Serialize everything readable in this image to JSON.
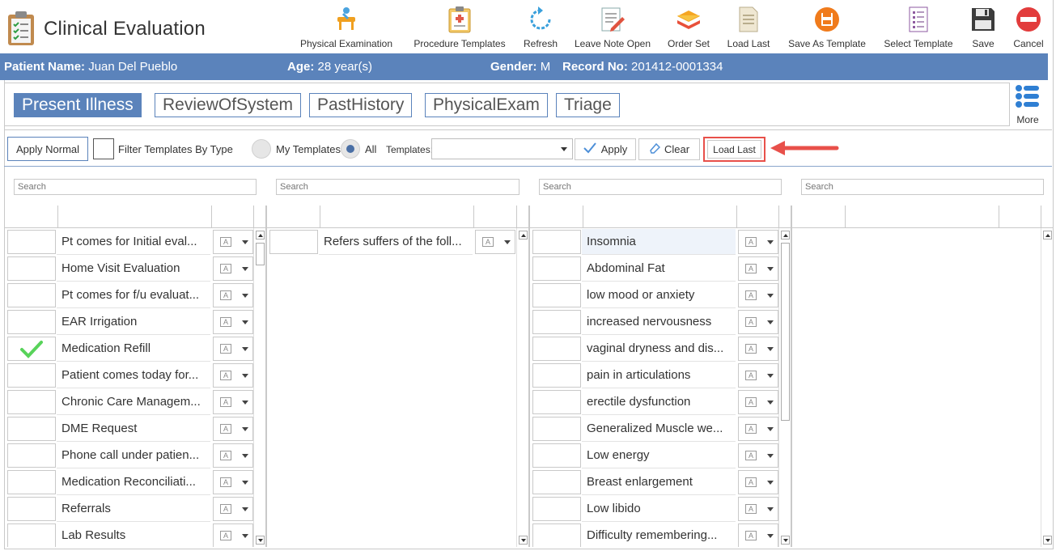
{
  "app": {
    "title": "Clinical Evaluation"
  },
  "toolbar": {
    "items": [
      {
        "label": "Physical Examination",
        "icon": "physical-exam-icon"
      },
      {
        "label": "Procedure Templates",
        "icon": "clipboard-icon"
      },
      {
        "label": "Refresh",
        "icon": "refresh-icon"
      },
      {
        "label": "Leave Note Open",
        "icon": "note-pencil-icon"
      },
      {
        "label": "Order Set",
        "icon": "layers-icon"
      },
      {
        "label": "Load Last",
        "icon": "document-icon"
      },
      {
        "label": "Save As Template",
        "icon": "save-template-icon"
      },
      {
        "label": "Select Template",
        "icon": "list-document-icon"
      },
      {
        "label": "Save",
        "icon": "floppy-icon"
      },
      {
        "label": "Cancel",
        "icon": "cancel-icon"
      }
    ]
  },
  "patient": {
    "name_label": "Patient Name:",
    "name": "Juan Del Pueblo",
    "age_label": "Age:",
    "age": "28 year(s)",
    "gender_label": "Gender:",
    "gender": "M",
    "record_label": "Record No:",
    "record": "201412-0001334"
  },
  "tabs": [
    {
      "label": "Present Illness",
      "active": true
    },
    {
      "label": "ReviewOfSystem",
      "active": false
    },
    {
      "label": "PastHistory",
      "active": false
    },
    {
      "label": "PhysicalExam",
      "active": false
    },
    {
      "label": "Triage",
      "active": false
    }
  ],
  "more": {
    "label": "More"
  },
  "filters": {
    "apply_normal": "Apply Normal",
    "filter_by_type": "Filter Templates By Type",
    "my_templates": "My Templates",
    "all": "All",
    "templates_label": "Templates:",
    "templates_value": "",
    "apply": "Apply",
    "clear": "Clear",
    "load_last": "Load Last"
  },
  "search_placeholder": "Search",
  "columns": [
    {
      "rows": [
        {
          "text": "Pt comes for Initial eval...",
          "checked": false
        },
        {
          "text": "Home Visit Evaluation",
          "checked": false
        },
        {
          "text": "Pt comes for f/u evaluat...",
          "checked": false
        },
        {
          "text": "EAR Irrigation",
          "checked": false
        },
        {
          "text": "Medication Refill",
          "checked": true
        },
        {
          "text": "Patient comes today for...",
          "checked": false
        },
        {
          "text": "Chronic Care Managem...",
          "checked": false
        },
        {
          "text": "DME Request",
          "checked": false
        },
        {
          "text": "Phone call under patien...",
          "checked": false
        },
        {
          "text": "Medication Reconciliati...",
          "checked": false
        },
        {
          "text": "Referrals",
          "checked": false
        },
        {
          "text": "Lab Results",
          "checked": false
        }
      ]
    },
    {
      "rows": [
        {
          "text": "Refers suffers of the foll...",
          "checked": false
        }
      ]
    },
    {
      "rows": [
        {
          "text": "Insomnia",
          "checked": false
        },
        {
          "text": "Abdominal Fat",
          "checked": false
        },
        {
          "text": "low mood or anxiety",
          "checked": false
        },
        {
          "text": "increased nervousness",
          "checked": false
        },
        {
          "text": "vaginal dryness and dis...",
          "checked": false
        },
        {
          "text": "pain in articulations",
          "checked": false
        },
        {
          "text": "erectile dysfunction",
          "checked": false
        },
        {
          "text": "Generalized Muscle we...",
          "checked": false
        },
        {
          "text": "Low energy",
          "checked": false
        },
        {
          "text": "Breast enlargement",
          "checked": false
        },
        {
          "text": "Low libido",
          "checked": false
        },
        {
          "text": "Difficulty remembering...",
          "checked": false
        }
      ]
    },
    {
      "rows": []
    }
  ],
  "colors": {
    "accent": "#5b83bb",
    "callout": "#e8504a",
    "check": "#58d35a"
  }
}
